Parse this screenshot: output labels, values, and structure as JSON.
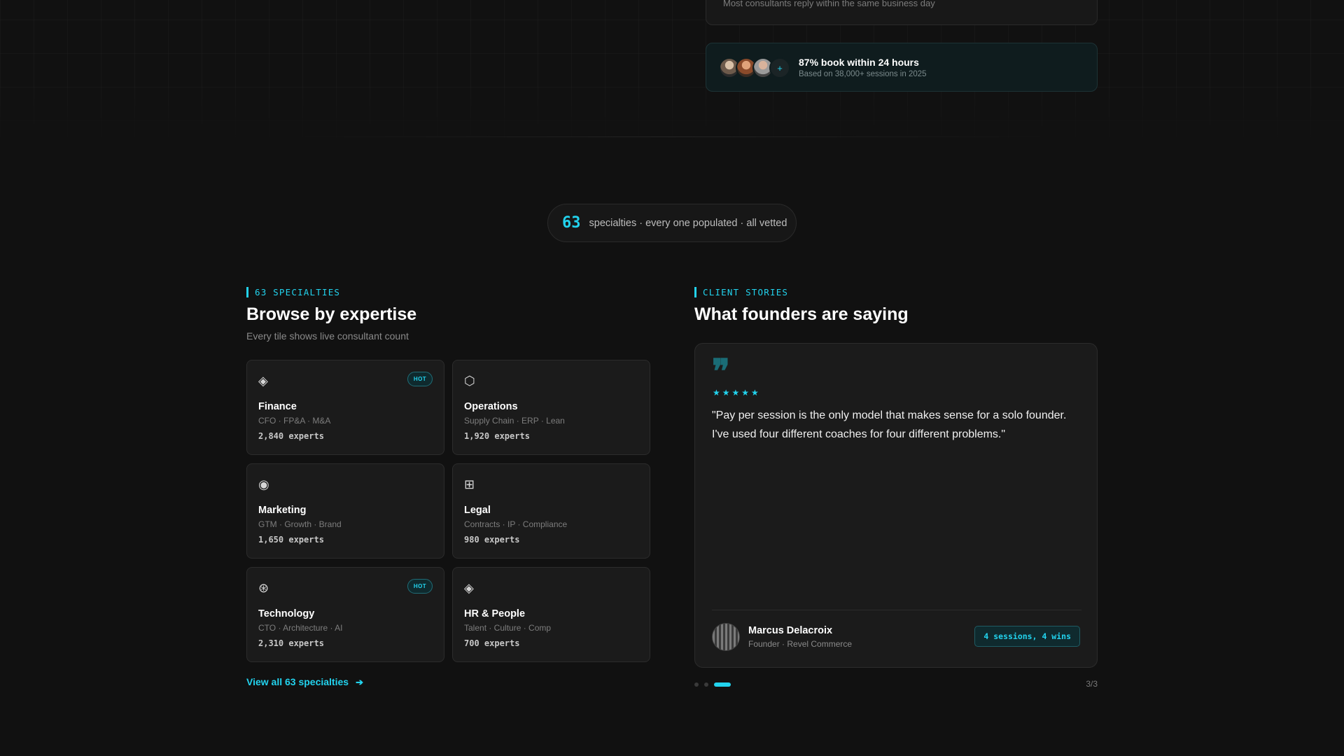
{
  "top": {
    "reply_note": "Most consultants reply within the same business day",
    "proof": {
      "avatar_more": "+",
      "title": "87% book within 24 hours",
      "subtitle": "Based on 38,000+ sessions in 2025"
    }
  },
  "stat": {
    "number": "63",
    "text": "specialties · every one populated · all vetted"
  },
  "specialties": {
    "eyebrow": "63 SPECIALTIES",
    "title": "Browse by expertise",
    "subtitle": "Every tile shows live consultant count",
    "tiles": [
      {
        "icon": "◈",
        "icon_name": "diamond-icon",
        "name": "Finance",
        "tags": "CFO · FP&A · M&A",
        "count": "2,840 experts",
        "badge": "HOT"
      },
      {
        "icon": "⬡",
        "icon_name": "hexagon-icon",
        "name": "Operations",
        "tags": "Supply Chain · ERP · Lean",
        "count": "1,920 experts",
        "badge": ""
      },
      {
        "icon": "◉",
        "icon_name": "target-icon",
        "name": "Marketing",
        "tags": "GTM · Growth · Brand",
        "count": "1,650 experts",
        "badge": ""
      },
      {
        "icon": "⊞",
        "icon_name": "grid-box-icon",
        "name": "Legal",
        "tags": "Contracts · IP · Compliance",
        "count": "980 experts",
        "badge": ""
      },
      {
        "icon": "⊛",
        "icon_name": "asterisk-circle-icon",
        "name": "Technology",
        "tags": "CTO · Architecture · AI",
        "count": "2,310 experts",
        "badge": "HOT"
      },
      {
        "icon": "◈",
        "icon_name": "diamond-icon",
        "name": "HR & People",
        "tags": "Talent · Culture · Comp",
        "count": "700 experts",
        "badge": ""
      }
    ],
    "view_all": "View all 63 specialties",
    "view_all_arrow": "➔"
  },
  "stories": {
    "eyebrow": "CLIENT STORIES",
    "title": "What founders are saying",
    "quote_mark": "❞",
    "stars": "★★★★★",
    "rating": 5,
    "quote": "\"Pay per session is the only model that makes sense for a solo founder. I've used four different coaches for four different problems.\"",
    "author_name": "Marcus Delacroix",
    "author_role": "Founder · Revel Commerce",
    "badge": "4 sessions, 4 wins",
    "pager": "3/3",
    "active_slide": 3,
    "total_slides": 3
  },
  "colors": {
    "accent": "#22d3ee",
    "background": "#111111",
    "card": "#1b1b1b"
  }
}
